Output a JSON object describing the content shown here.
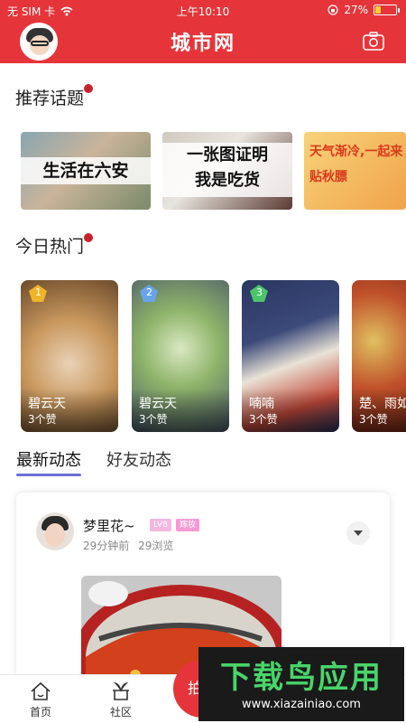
{
  "status_bar": {
    "carrier": "无 SIM 卡",
    "time": "上午10:10",
    "battery": "27%",
    "battery_level": 0.27
  },
  "header": {
    "title": "城市网"
  },
  "recommended": {
    "title": "推荐话题",
    "topics": [
      {
        "text": "生活在六安"
      },
      {
        "text": "一张图证明\n我是吃货"
      },
      {
        "text": "天气渐冷,一起来\n贴秋膘"
      }
    ]
  },
  "today_hot": {
    "title": "今日热门",
    "cards": [
      {
        "rank": "1",
        "name": "碧云天",
        "likes": "3个赞"
      },
      {
        "rank": "2",
        "name": "碧云天",
        "likes": "3个赞"
      },
      {
        "rank": "3",
        "name": "喃喃",
        "likes": "3个赞"
      },
      {
        "rank": "",
        "name": "楚、雨如",
        "likes": "3个赞"
      }
    ]
  },
  "tabs": {
    "latest": "最新动态",
    "friends": "好友动态"
  },
  "post": {
    "user": "梦里花~",
    "level": "LV8",
    "tag": "嫁妆",
    "time": "29分钟前",
    "views": "29浏览"
  },
  "bottom_nav": {
    "home": "首页",
    "community": "社区",
    "shoot": "拍"
  },
  "watermark": {
    "big": "下载鸟应用",
    "small": "www.xiazainiao.com"
  },
  "colors": {
    "brand": "#e5353a",
    "accent_tab": "#6b6fd6"
  }
}
